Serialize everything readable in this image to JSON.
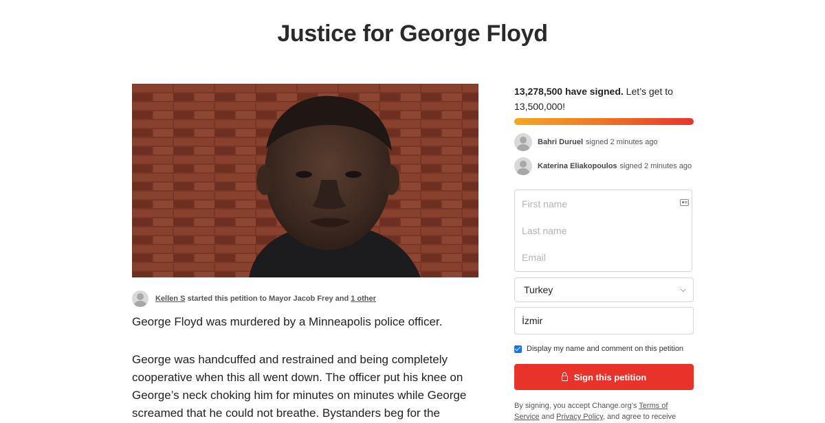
{
  "petition": {
    "title": "Justice for George Floyd",
    "starter": {
      "name": "Kellen S",
      "text": "started this petition to Mayor Jacob Frey and",
      "other_link": "1 other"
    },
    "lead": "George Floyd was murdered by a Minneapolis police officer.",
    "body_lines": [
      "George was handcuffed and restrained and being completely",
      "cooperative when this all went down. The officer put his knee on",
      "George’s neck choking him for minutes on minutes while George",
      "screamed that he could not breathe. Bystanders beg for the"
    ]
  },
  "signatures": {
    "count_bold": "13,278,500 have signed.",
    "count_rest": "Let’s get to",
    "goal": "13,500,000!",
    "progress_fraction": 0.98,
    "recent": [
      {
        "name": "Bahri Duruel",
        "time": "signed 2 minutes ago"
      },
      {
        "name": "Katerina Eliakopoulos",
        "time": "signed 2 minutes ago"
      }
    ]
  },
  "form": {
    "first_name_placeholder": "First name",
    "last_name_placeholder": "Last name",
    "email_placeholder": "Email",
    "country": "Turkey",
    "city": "İzmir",
    "display_checkbox_label": "Display my name and comment on this petition",
    "sign_button": "Sign this petition",
    "legal_prefix": "By signing, you accept Change.org’s",
    "terms_link": "Terms of Service",
    "legal_and": "and",
    "privacy_link": "Privacy Policy",
    "legal_suffix": ", and agree to receive"
  },
  "colors": {
    "accent": "#e8332a",
    "progress_start": "#f5a623",
    "checkbox": "#1a73e8"
  }
}
